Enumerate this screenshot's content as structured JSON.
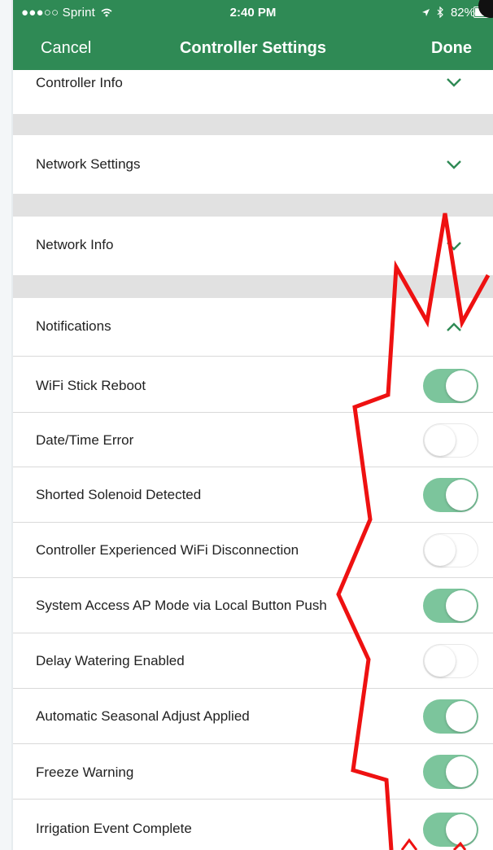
{
  "status_bar": {
    "carrier": "●●●○○ Sprint",
    "wifi_icon": "wifi-icon",
    "time": "2:40 PM",
    "location_icon": "location-arrow-icon",
    "bluetooth_icon": "bluetooth-icon",
    "battery": "82%",
    "battery_level": 0.82
  },
  "nav": {
    "cancel": "Cancel",
    "title": "Controller Settings",
    "done": "Done"
  },
  "sections": [
    {
      "label": "Controller Info",
      "expanded": false,
      "icon": "chevron-down-icon"
    },
    {
      "label": "Network Settings",
      "expanded": false,
      "icon": "chevron-down-icon"
    },
    {
      "label": "Network Info",
      "expanded": false,
      "icon": "chevron-down-icon"
    },
    {
      "label": "Notifications",
      "expanded": true,
      "icon": "chevron-up-icon"
    }
  ],
  "notifications": [
    {
      "label": "WiFi Stick Reboot",
      "enabled": true
    },
    {
      "label": "Date/Time Error",
      "enabled": false
    },
    {
      "label": "Shorted Solenoid Detected",
      "enabled": true
    },
    {
      "label": "Controller Experienced WiFi Disconnection",
      "enabled": false
    },
    {
      "label": "System Access AP Mode via Local Button Push",
      "enabled": true
    },
    {
      "label": "Delay Watering Enabled",
      "enabled": false
    },
    {
      "label": "Automatic Seasonal Adjust Applied",
      "enabled": true
    },
    {
      "label": "Freeze Warning",
      "enabled": true
    },
    {
      "label": "Irrigation Event Complete",
      "enabled": true
    }
  ],
  "colors": {
    "nav_background": "#2f8a55",
    "accent": "#2f8a55",
    "toggle_on": "#7cc59c",
    "section_gap": "#e1e1e1",
    "annotation_red": "#ee1111"
  }
}
